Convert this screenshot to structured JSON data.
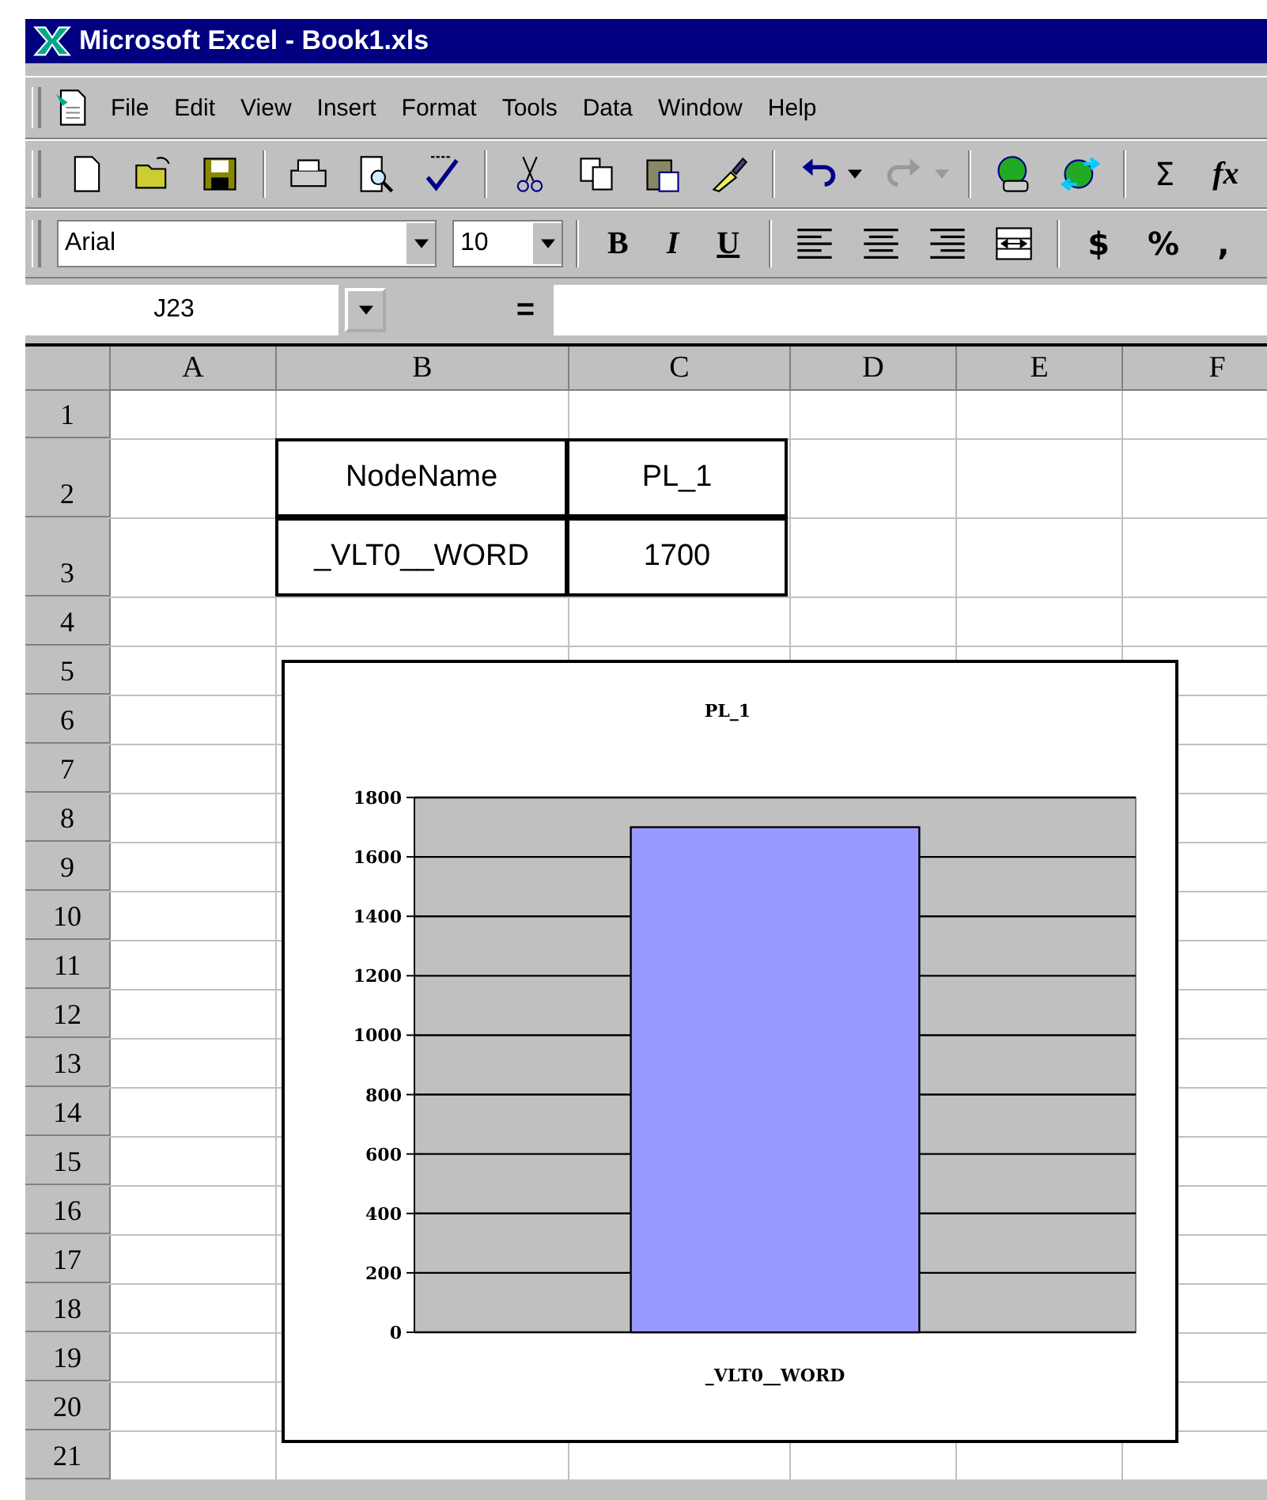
{
  "window": {
    "title": "Microsoft Excel - Book1.xls"
  },
  "menu": [
    "File",
    "Edit",
    "View",
    "Insert",
    "Format",
    "Tools",
    "Data",
    "Window",
    "Help"
  ],
  "standard_toolbar": {
    "symbols": [
      {
        "kind": "sum",
        "label": "Σ"
      },
      {
        "kind": "function",
        "label": "fx"
      }
    ]
  },
  "formatting_toolbar": {
    "font": "Arial",
    "size": "10",
    "styles": [
      {
        "kind": "bold",
        "label": "B"
      },
      {
        "kind": "italic",
        "label": "I"
      },
      {
        "kind": "underline",
        "label": "U"
      }
    ],
    "symbols": [
      "$",
      "%",
      ","
    ]
  },
  "formula_bar": {
    "name_box": "J23",
    "equals": "="
  },
  "sheet": {
    "columns": [
      "A",
      "B",
      "C",
      "D",
      "E",
      "F"
    ],
    "rows": [
      {
        "number": "1",
        "tall": false
      },
      {
        "number": "2",
        "tall": true,
        "cells": [
          {},
          {
            "value": "NodeName",
            "bordered": true
          },
          {
            "value": "PL_1",
            "bordered": true
          }
        ]
      },
      {
        "number": "3",
        "tall": true,
        "cells": [
          {},
          {
            "value": "_VLT0__WORD",
            "bordered": true
          },
          {
            "value": "1700",
            "bordered": true
          }
        ]
      },
      {
        "number": "4",
        "tall": false
      },
      {
        "number": "5",
        "tall": false
      },
      {
        "number": "6",
        "tall": false
      },
      {
        "number": "7",
        "tall": false
      },
      {
        "number": "8",
        "tall": false
      },
      {
        "number": "9",
        "tall": false
      },
      {
        "number": "10",
        "tall": false
      },
      {
        "number": "11",
        "tall": false
      },
      {
        "number": "12",
        "tall": false
      },
      {
        "number": "13",
        "tall": false
      },
      {
        "number": "14",
        "tall": false
      },
      {
        "number": "15",
        "tall": false
      },
      {
        "number": "16",
        "tall": false
      },
      {
        "number": "17",
        "tall": false
      },
      {
        "number": "18",
        "tall": false
      },
      {
        "number": "19",
        "tall": false
      },
      {
        "number": "20",
        "tall": false
      },
      {
        "number": "21",
        "tall": false
      }
    ]
  },
  "chart": {
    "chart_data": {
      "type": "bar",
      "title": "PL_1",
      "categories": [
        "_VLT0__WORD"
      ],
      "values": [
        1700
      ],
      "grid": true,
      "ylim": [
        0,
        1800
      ],
      "yticks": [
        0,
        200,
        400,
        600,
        800,
        1000,
        1200,
        1400,
        1600,
        1800
      ]
    }
  }
}
